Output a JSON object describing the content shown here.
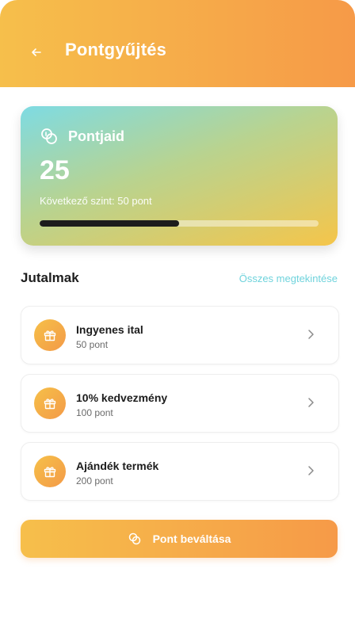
{
  "header": {
    "title": "Pontgyűjtés",
    "back_icon": "arrow-left-icon",
    "gradient": [
      "#f6bf4b",
      "#f69a48"
    ]
  },
  "points_card": {
    "title": "Pontjaid",
    "icon": "coins-icon",
    "value": "25",
    "next_level": "Következő szint: 50 pont",
    "progress": 0.5
  },
  "rewards": {
    "title": "Jutalmak",
    "view_all": "Összes megtekintése",
    "items": [
      {
        "name": "Ingyenes ital",
        "points": "50 pont",
        "icon": "gift-icon"
      },
      {
        "name": "10% kedvezmény",
        "points": "100 pont",
        "icon": "gift-icon"
      },
      {
        "name": "Ajándék termék",
        "points": "200 pont",
        "icon": "gift-icon"
      }
    ]
  },
  "redeem_button": {
    "label": "Pont beváltása",
    "icon": "coins-icon"
  },
  "colors": {
    "accent": "#f69a48",
    "accent_light": "#f6bf4b",
    "link": "#6fd3dc",
    "progress_fill": "#1c1c1c"
  }
}
